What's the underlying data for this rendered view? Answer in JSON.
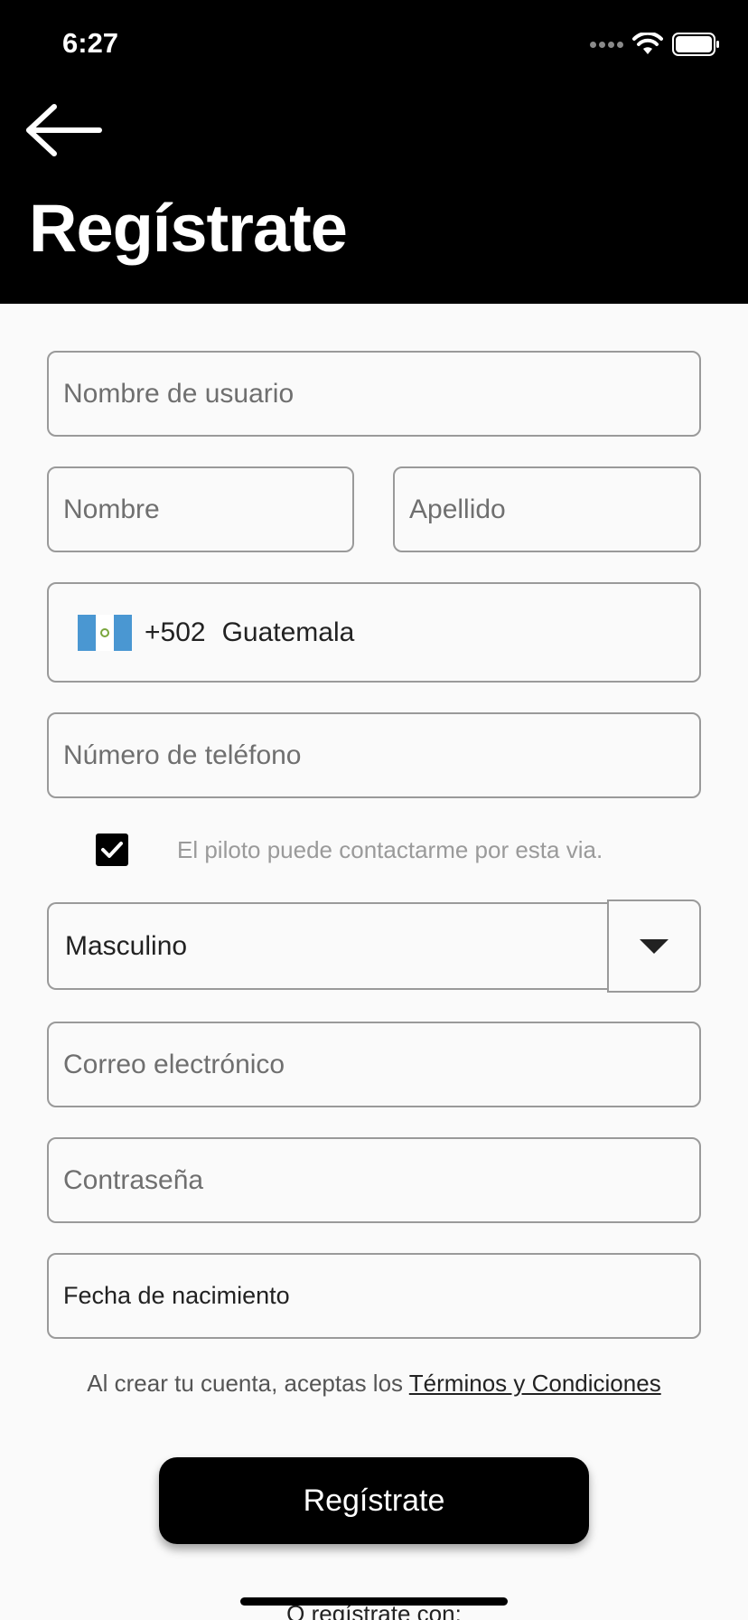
{
  "status_bar": {
    "time": "6:27"
  },
  "header": {
    "title": "Regístrate",
    "back_icon": "arrow-left-icon"
  },
  "form": {
    "username": {
      "placeholder": "Nombre de usuario"
    },
    "first_name": {
      "placeholder": "Nombre"
    },
    "last_name": {
      "placeholder": "Apellido"
    },
    "country": {
      "code": "+502",
      "name": "Guatemala",
      "flag_icon": "guatemala-flag-icon"
    },
    "phone": {
      "placeholder": "Número de teléfono"
    },
    "contact_consent": {
      "label": "El piloto puede contactarme por esta via.",
      "checked": true
    },
    "gender": {
      "selected": "Masculino"
    },
    "email": {
      "placeholder": "Correo electrónico"
    },
    "password": {
      "placeholder": "Contraseña"
    },
    "birthdate": {
      "placeholder": "Fecha de nacimiento"
    }
  },
  "terms": {
    "prefix": "Al crear tu cuenta, aceptas los ",
    "link": "Términos y Condiciones"
  },
  "submit_label": "Regístrate",
  "alt_register_label": "O regístrate con:",
  "colors": {
    "header_bg": "#000000",
    "button_bg": "#000000",
    "page_bg": "#fafafa",
    "flag_blue": "#4a97d2"
  }
}
